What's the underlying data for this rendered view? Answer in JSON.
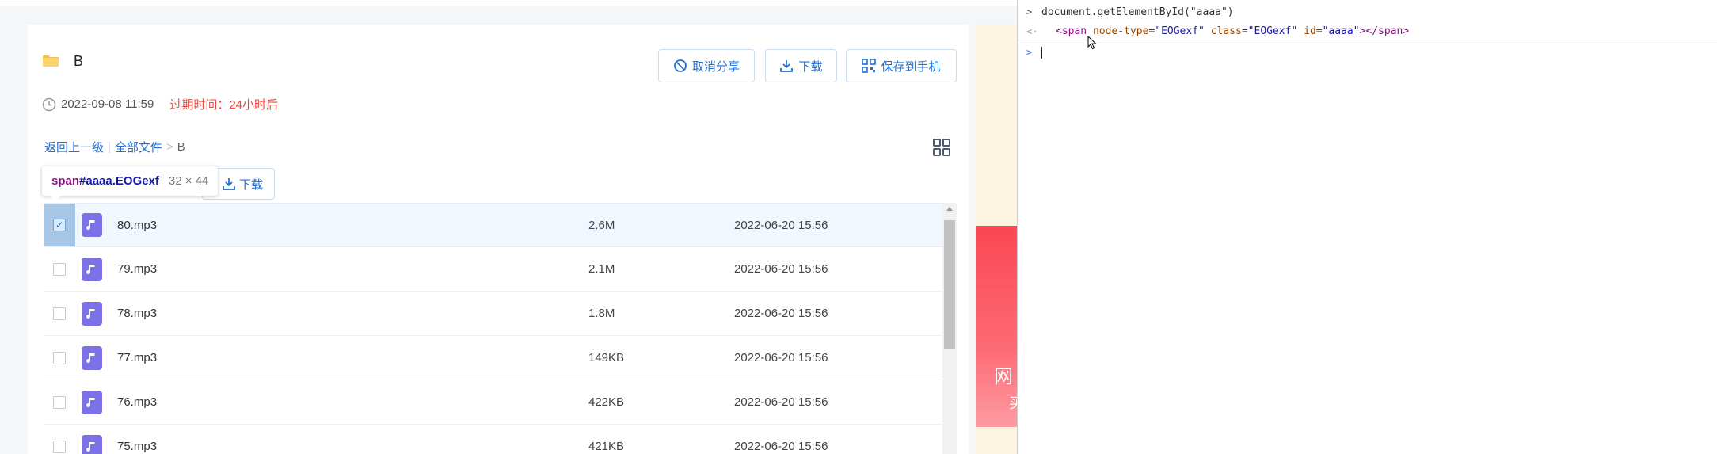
{
  "header": {
    "folder_name": "B",
    "actions": [
      {
        "label": "取消分享",
        "icon": "cancel-icon"
      },
      {
        "label": "下载",
        "icon": "download-icon"
      },
      {
        "label": "保存到手机",
        "icon": "qrcode-icon"
      }
    ],
    "date": "2022-09-08 11:59",
    "expire": "过期时间：24小时后"
  },
  "breadcrumb": {
    "back": "返回上一级",
    "all_files": "全部文件",
    "separator": ">",
    "current": "B"
  },
  "tooltip": {
    "selector_tag": "span",
    "selector_rest": "#aaaa.EOGexf",
    "size": "32 × 44"
  },
  "toolbar": {
    "download_label": "下载"
  },
  "files": [
    {
      "name": "80.mp3",
      "size": "2.6M",
      "date": "2022-06-20 15:56",
      "selected": true
    },
    {
      "name": "79.mp3",
      "size": "2.1M",
      "date": "2022-06-20 15:56",
      "selected": false
    },
    {
      "name": "78.mp3",
      "size": "1.8M",
      "date": "2022-06-20 15:56",
      "selected": false
    },
    {
      "name": "77.mp3",
      "size": "149KB",
      "date": "2022-06-20 15:56",
      "selected": false
    },
    {
      "name": "76.mp3",
      "size": "422KB",
      "date": "2022-06-20 15:56",
      "selected": false
    },
    {
      "name": "75.mp3",
      "size": "421KB",
      "date": "2022-06-20 15:56",
      "selected": false
    }
  ],
  "ad": {
    "text1": "网",
    "text2": "买"
  },
  "console": {
    "prompt": ">",
    "result_marker": "<·",
    "input": "document.getElementById(\"aaaa\")",
    "output": {
      "open": "<span",
      "a1": "node-type",
      "v1": "\"EOGexf\"",
      "a2": "class",
      "v2": "\"EOGexf\"",
      "a3": "id",
      "v3": "\"aaaa\"",
      "close": "></span>"
    }
  },
  "colors": {
    "accent": "#1f6fd6",
    "expire": "#f0463b",
    "file_icon": "#7c71e6",
    "selected_row": "#f0f7fe"
  }
}
